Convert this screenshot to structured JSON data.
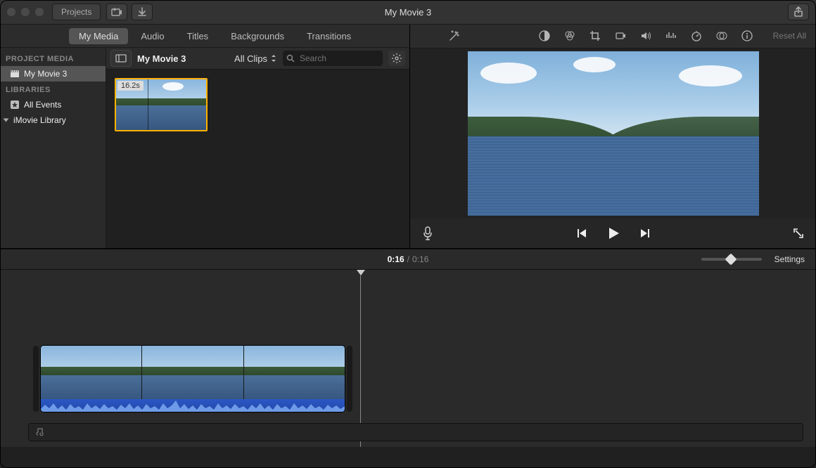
{
  "titlebar": {
    "projects_label": "Projects",
    "window_title": "My Movie 3"
  },
  "tabs": {
    "my_media": "My Media",
    "audio": "Audio",
    "titles": "Titles",
    "backgrounds": "Backgrounds",
    "transitions": "Transitions"
  },
  "media_header": {
    "event_title": "My Movie 3",
    "clips_dropdown": "All Clips",
    "search_placeholder": "Search"
  },
  "sidebar": {
    "project_media_label": "PROJECT MEDIA",
    "project_item": "My Movie 3",
    "libraries_label": "LIBRARIES",
    "all_events": "All Events",
    "imovie_library": "iMovie Library"
  },
  "browser": {
    "clip_duration": "16.2s"
  },
  "adjust_bar": {
    "reset_all": "Reset All"
  },
  "status": {
    "time_current": "0:16",
    "time_sep": "/",
    "time_total": "0:16",
    "settings": "Settings"
  }
}
